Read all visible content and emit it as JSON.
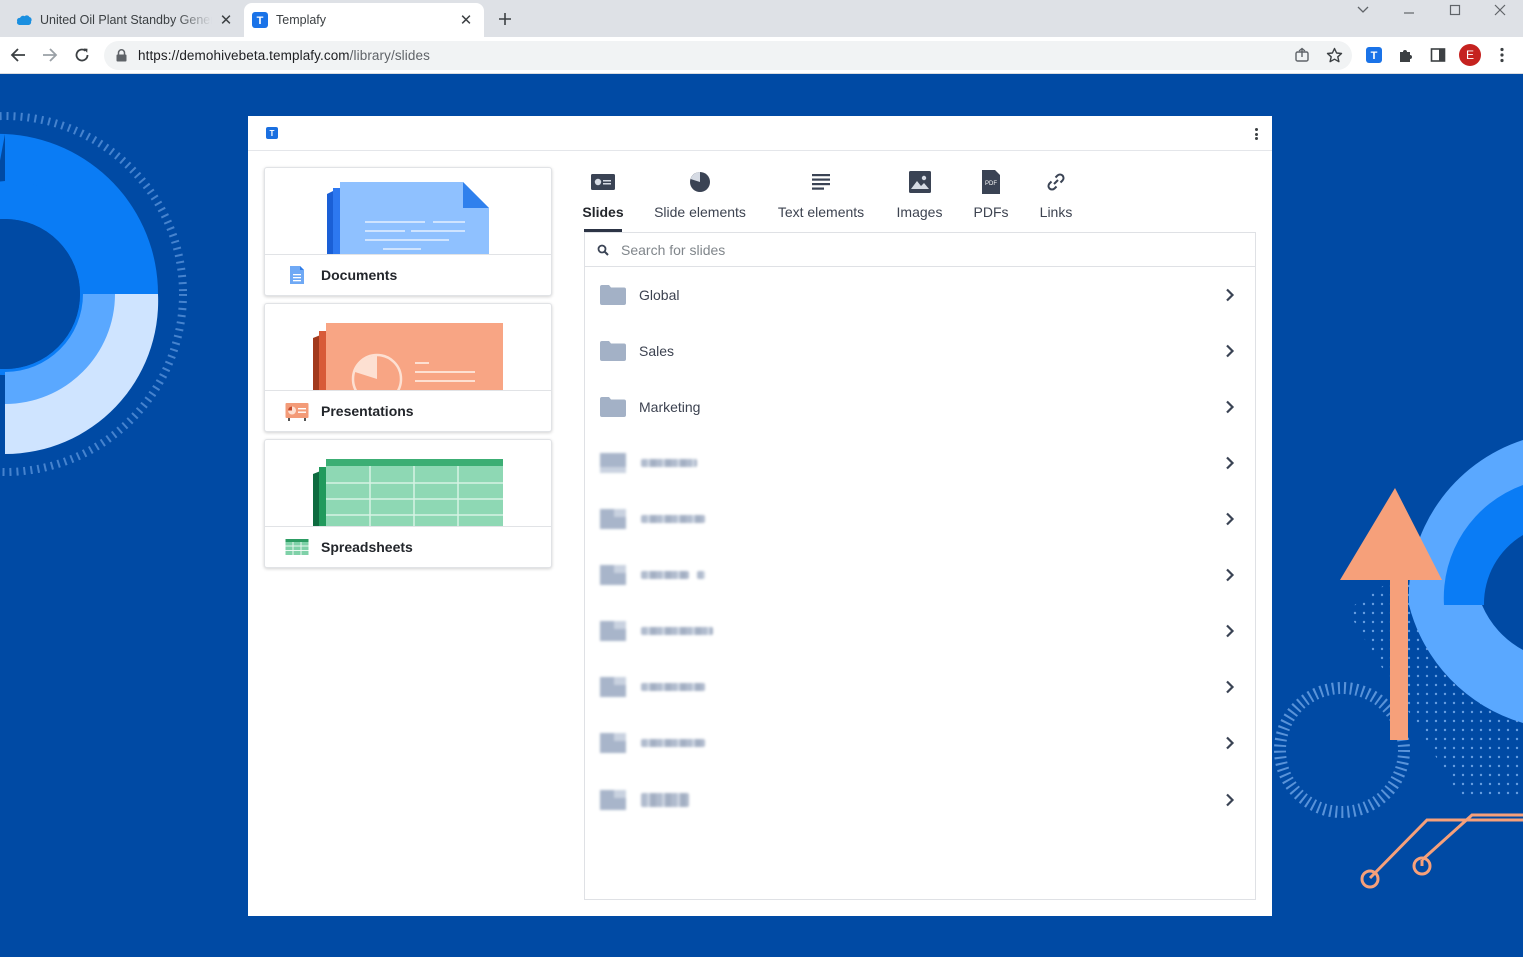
{
  "browser": {
    "tabs": [
      {
        "title": "United Oil Plant Standby Generat",
        "favicon": "salesforce-cloud-icon",
        "active": false
      },
      {
        "title": "Templafy",
        "favicon": "templafy-icon",
        "active": true
      }
    ],
    "url_host": "https://demohivebeta.templafy.com",
    "url_path": "/library/slides",
    "profile_initial": "E",
    "colors": {
      "profile": "#c5221f",
      "templafy_ext": "#1a73e8"
    }
  },
  "app": {
    "logo": "T",
    "document_types": [
      {
        "label": "Documents",
        "icon": "document-icon"
      },
      {
        "label": "Presentations",
        "icon": "presentation-icon"
      },
      {
        "label": "Spreadsheets",
        "icon": "spreadsheet-icon"
      }
    ],
    "tabs": [
      {
        "label": "Slides",
        "icon": "slides-icon",
        "active": true
      },
      {
        "label": "Slide elements",
        "icon": "pie-chart-icon",
        "active": false
      },
      {
        "label": "Text elements",
        "icon": "text-lines-icon",
        "active": false
      },
      {
        "label": "Images",
        "icon": "image-icon",
        "active": false
      },
      {
        "label": "PDFs",
        "icon": "pdf-icon",
        "active": false
      },
      {
        "label": "Links",
        "icon": "link-icon",
        "active": false
      }
    ],
    "pdf_icon_text": "PDF",
    "search": {
      "placeholder": "Search for slides"
    },
    "folders": [
      {
        "name": "Global"
      },
      {
        "name": "Sales"
      },
      {
        "name": "Marketing"
      }
    ],
    "colors": {
      "background": "#004aa4",
      "folder": "#a3b1c6",
      "documents": "#8fc1ff",
      "presentations": "#f8a584",
      "spreadsheets": "#8ed8b4"
    }
  }
}
